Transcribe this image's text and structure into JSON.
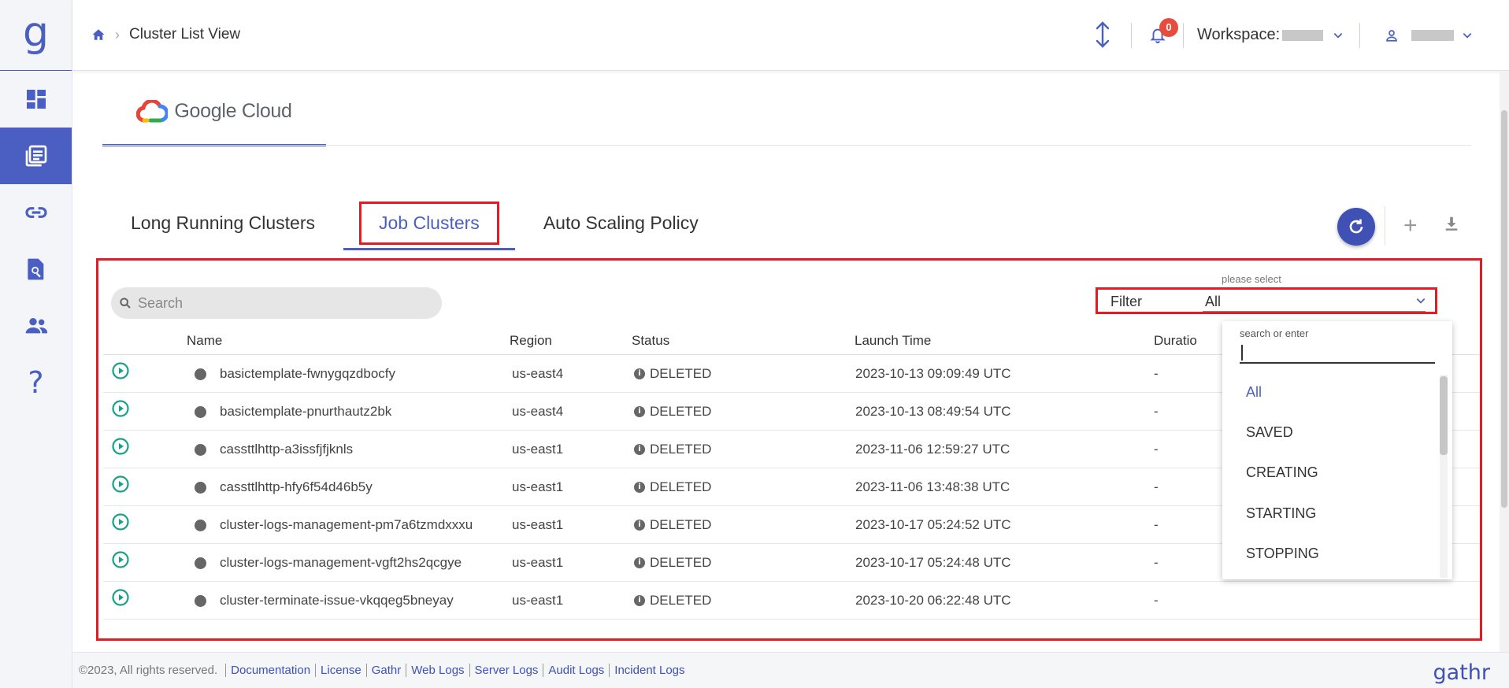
{
  "sidebar": {
    "logo": "g",
    "items": [
      {
        "icon": "dashboard-icon",
        "active": false
      },
      {
        "icon": "clusters-icon",
        "active": true
      },
      {
        "icon": "link-icon",
        "active": false
      },
      {
        "icon": "search-document-icon",
        "active": false
      },
      {
        "icon": "users-icon",
        "active": false
      },
      {
        "icon": "help-icon",
        "label": "?",
        "active": false
      }
    ]
  },
  "topbar": {
    "breadcrumb": {
      "current": "Cluster List View"
    },
    "notification_count": "0",
    "workspace_label": "Workspace:"
  },
  "cloud": {
    "name": "Google Cloud"
  },
  "tabs": [
    {
      "label": "Long Running Clusters"
    },
    {
      "label": "Job Clusters",
      "active": true
    },
    {
      "label": "Auto Scaling Policy"
    }
  ],
  "search": {
    "placeholder": "Search"
  },
  "filter": {
    "label": "Filter",
    "hint": "please select",
    "value": "All"
  },
  "table": {
    "columns": [
      "Name",
      "Region",
      "Status",
      "Launch Time",
      "Duratio"
    ],
    "rows": [
      {
        "name": "basictemplate-fwnygqzdbocfy",
        "region": "us-east4",
        "status": "DELETED",
        "launch": "2023-10-13 09:09:49 UTC",
        "duration": "-"
      },
      {
        "name": "basictemplate-pnurthautz2bk",
        "region": "us-east4",
        "status": "DELETED",
        "launch": "2023-10-13 08:49:54 UTC",
        "duration": "-"
      },
      {
        "name": "cassttlhttp-a3issfjfjknls",
        "region": "us-east1",
        "status": "DELETED",
        "launch": "2023-11-06 12:59:27 UTC",
        "duration": "-"
      },
      {
        "name": "cassttlhttp-hfy6f54d46b5y",
        "region": "us-east1",
        "status": "DELETED",
        "launch": "2023-11-06 13:48:38 UTC",
        "duration": "-"
      },
      {
        "name": "cluster-logs-management-pm7a6tzmdxxxu",
        "region": "us-east1",
        "status": "DELETED",
        "launch": "2023-10-17 05:24:52 UTC",
        "duration": "-"
      },
      {
        "name": "cluster-logs-management-vgft2hs2qcgye",
        "region": "us-east1",
        "status": "DELETED",
        "launch": "2023-10-17 05:24:48 UTC",
        "duration": "-"
      },
      {
        "name": "cluster-terminate-issue-vkqqeg5bneyay",
        "region": "us-east1",
        "status": "DELETED",
        "launch": "2023-10-20 06:22:48 UTC",
        "duration": "-"
      }
    ]
  },
  "dropdown": {
    "hint": "search or enter",
    "options": [
      "All",
      "SAVED",
      "CREATING",
      "STARTING",
      "STOPPING"
    ],
    "selected": "All"
  },
  "footer": {
    "copyright": "©2023, All rights reserved.",
    "links": [
      "Documentation",
      "License",
      "Gathr",
      "Web Logs",
      "Server Logs",
      "Audit Logs",
      "Incident Logs"
    ],
    "brand": "gathr"
  },
  "colors": {
    "accent": "#4a5fc1",
    "highlight": "#e31b23",
    "play": "#1aa08a",
    "badge": "#e74c3c"
  }
}
